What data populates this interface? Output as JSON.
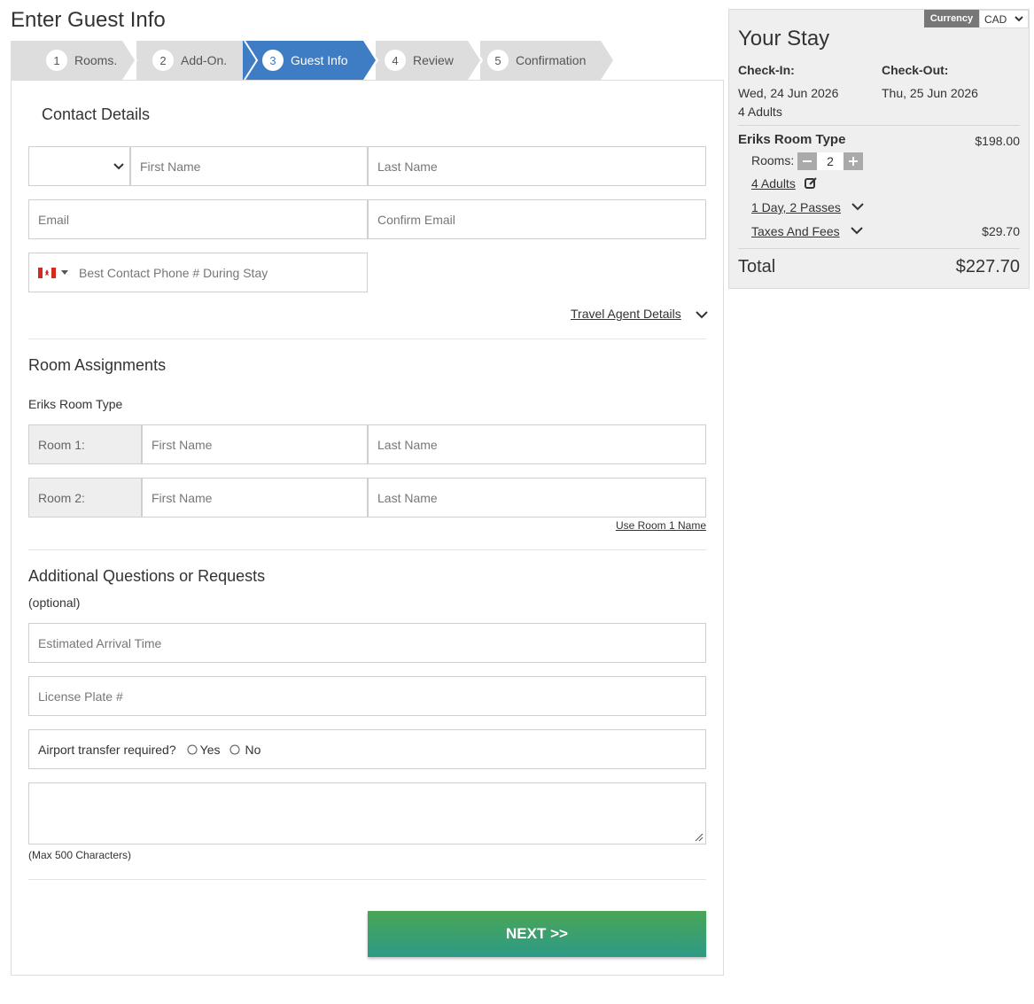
{
  "page": {
    "title": "Enter Guest Info"
  },
  "steps": [
    {
      "num": "1",
      "label": "Rooms."
    },
    {
      "num": "2",
      "label": "Add-On."
    },
    {
      "num": "3",
      "label": "Guest Info"
    },
    {
      "num": "4",
      "label": "Review"
    },
    {
      "num": "5",
      "label": "Confirmation"
    }
  ],
  "contact": {
    "title": "Contact Details",
    "first_name_ph": "First Name",
    "last_name_ph": "Last Name",
    "email_ph": "Email",
    "confirm_email_ph": "Confirm Email",
    "phone_ph": "Best Contact Phone # During Stay",
    "travel_agent_link": "Travel Agent Details"
  },
  "rooms": {
    "title": "Room Assignments",
    "room_type": "Eriks Room Type",
    "list": [
      {
        "label": "Room 1:",
        "first_ph": "First Name",
        "last_ph": "Last Name"
      },
      {
        "label": "Room 2:",
        "first_ph": "First Name",
        "last_ph": "Last Name"
      }
    ],
    "use_room1": "Use Room 1 Name"
  },
  "additional": {
    "title": "Additional Questions or Requests",
    "optional": "(optional)",
    "arrival_ph": "Estimated Arrival Time",
    "plate_ph": "License Plate #",
    "airport_q": "Airport transfer required?",
    "yes": "Yes",
    "no": "No",
    "max_chars": "(Max 500 Characters)"
  },
  "next_label": "NEXT >>",
  "stay": {
    "currency_label": "Currency",
    "currency_value": "CAD",
    "title": "Your Stay",
    "checkin_label": "Check-In:",
    "checkout_label": "Check-Out:",
    "checkin_date": "Wed, 24 Jun 2026",
    "checkout_date": "Thu, 25 Jun 2026",
    "guests": "4 Adults",
    "room_type": "Eriks Room Type",
    "room_price": "$198.00",
    "rooms_label": "Rooms:",
    "rooms_count": "2",
    "adults_link": "4 Adults",
    "passes_link": "1 Day, 2 Passes",
    "taxes_link": "Taxes And Fees",
    "taxes_amount": "$29.70",
    "total_label": "Total",
    "total_amount": "$227.70"
  },
  "colors": {
    "accent": "#3e7dc4",
    "next_top": "#4aa556",
    "next_bottom": "#2d9a86"
  },
  "icons": {
    "select_chevron": "chevron-down-icon",
    "flag": "canada-flag-icon",
    "edit": "edit-icon"
  }
}
